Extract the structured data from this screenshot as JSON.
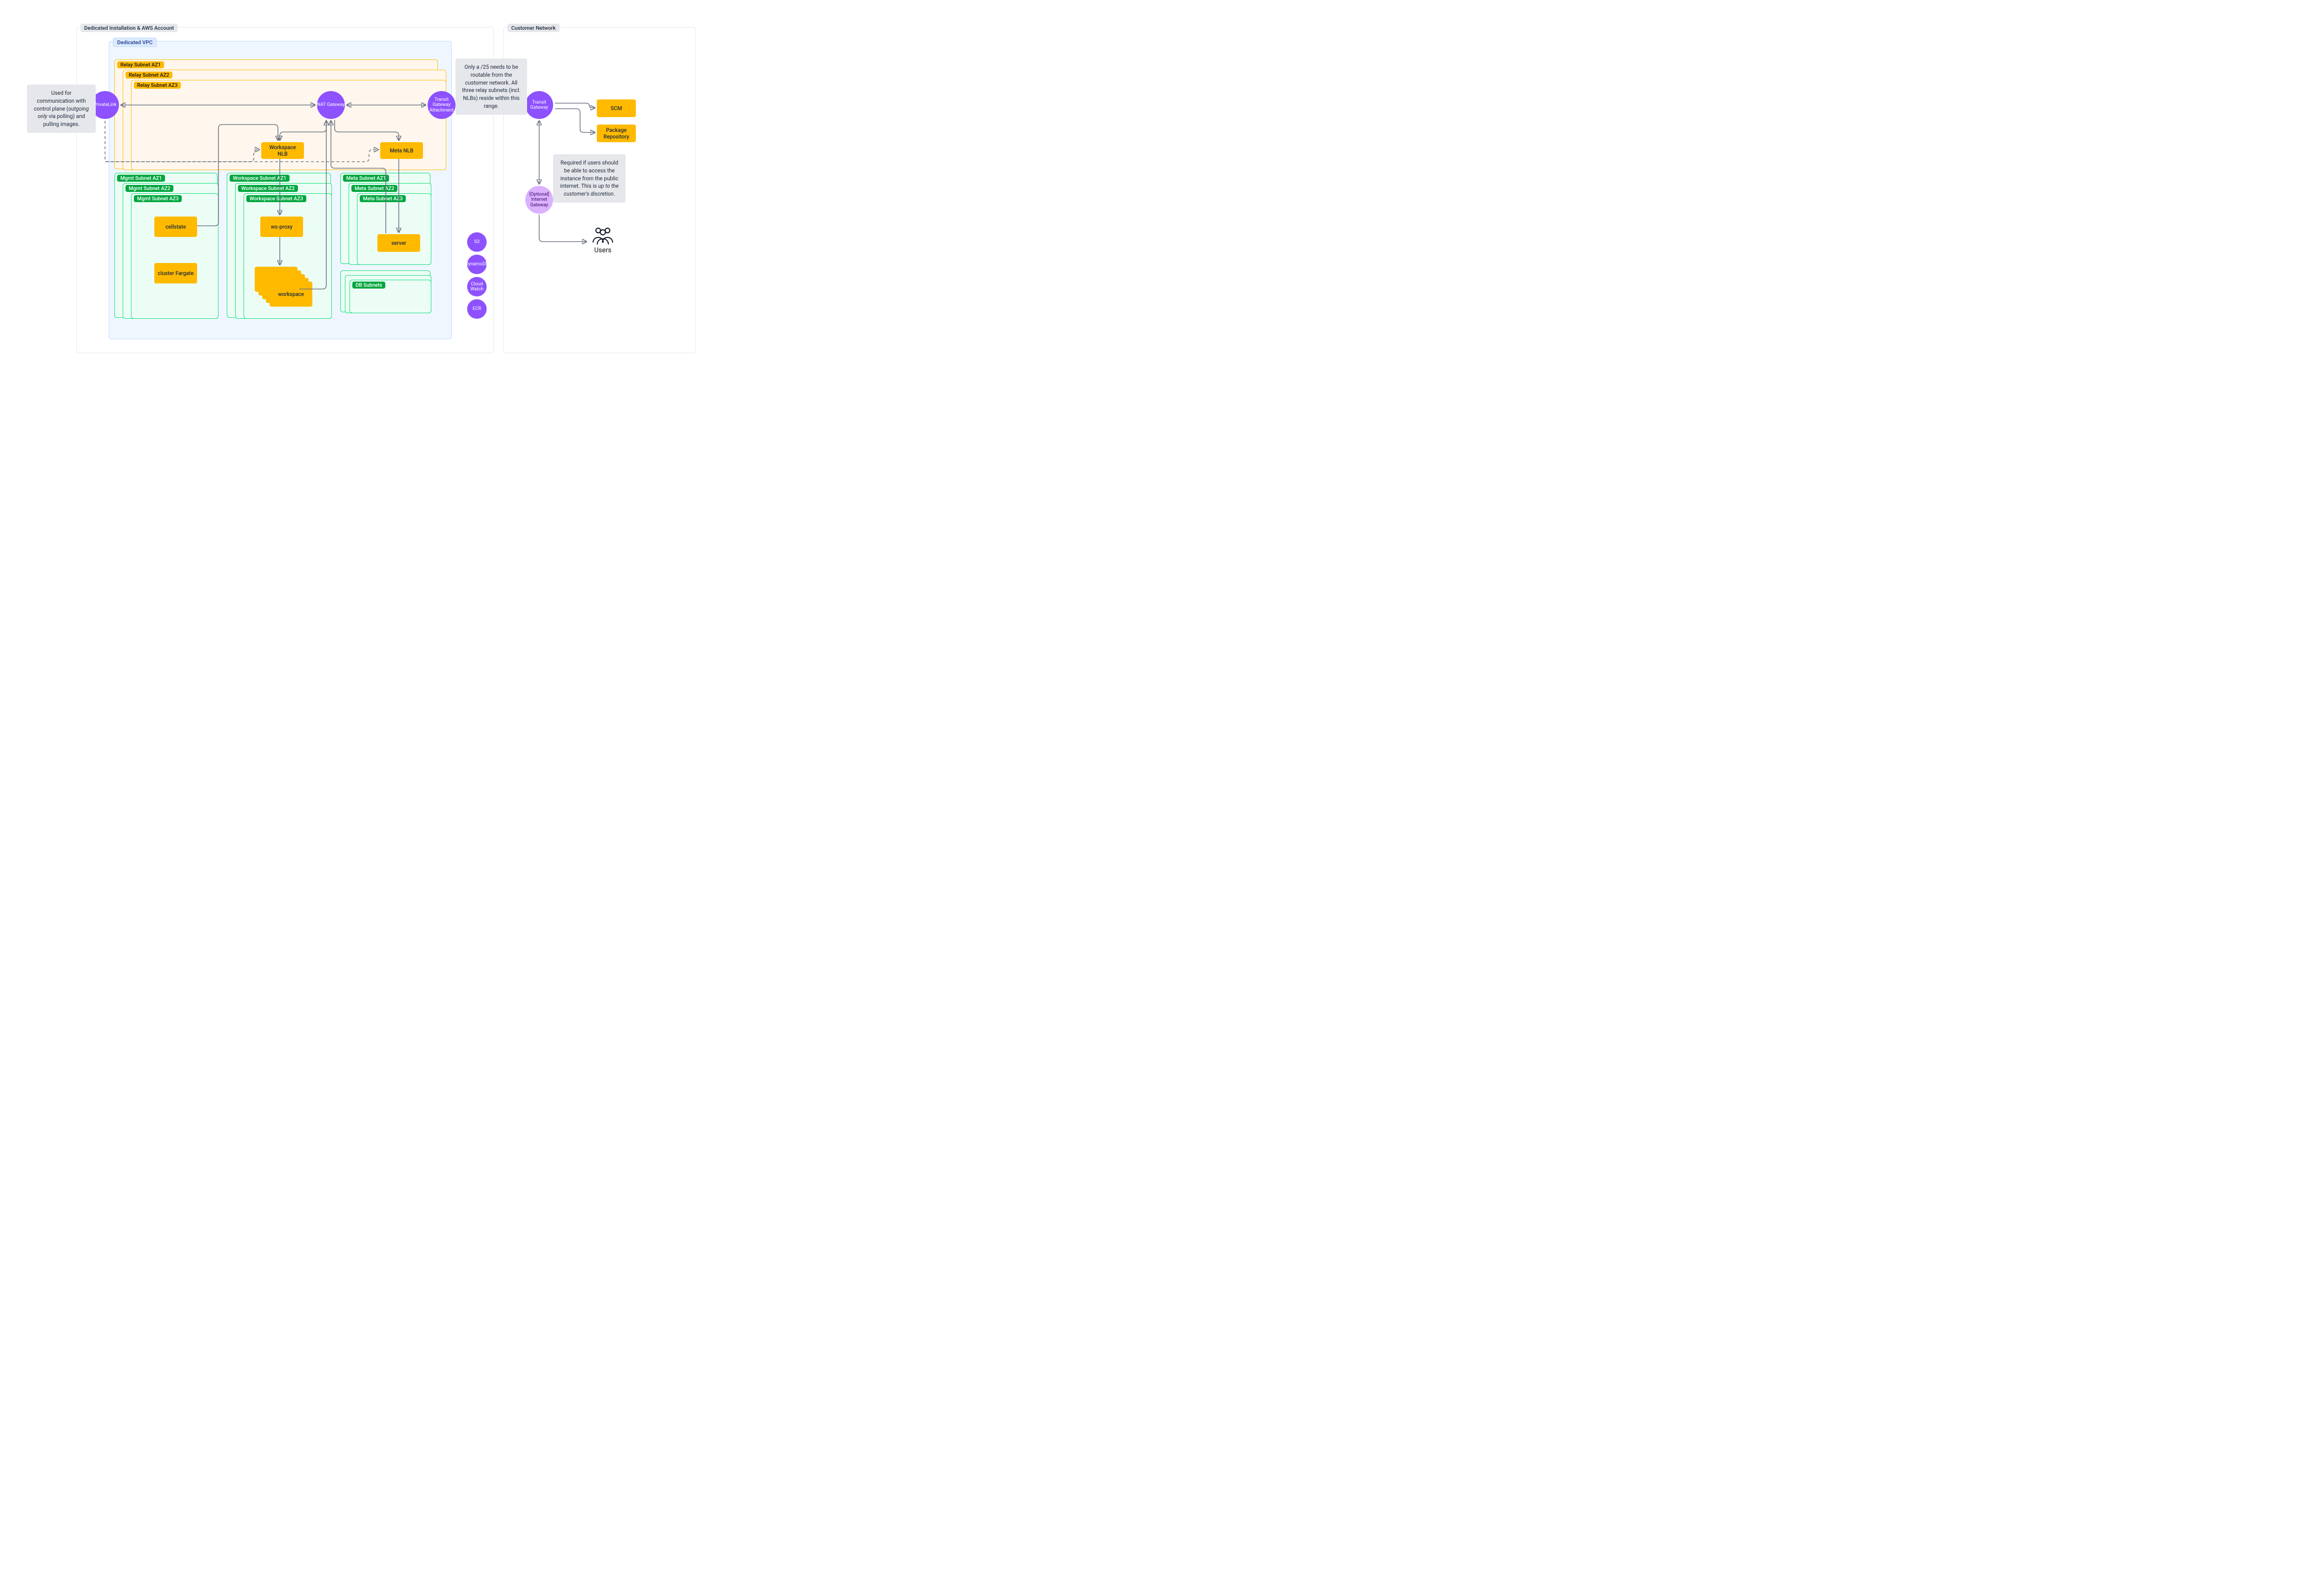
{
  "containers": {
    "install": "Dedicated Installation & AWS Account",
    "vpc": "Dedicated VPC",
    "network": "Customer Network"
  },
  "subnets": {
    "relay": [
      "Relay Subnet AZ1",
      "Relay Subnet AZ2",
      "Relay Subnet AZ3"
    ],
    "mgmt": [
      "Mgmt Subnet AZ1",
      "Mgmt Subnet AZ2",
      "Mgmt Subnet AZ3"
    ],
    "ws": [
      "Workspace Subnet AZ1",
      "Workspace Subnet AZ2",
      "Workspace Subnet AZ3"
    ],
    "meta": [
      "Meta Subnet AZ1",
      "Meta Subnet AZ2",
      "Meta Subnet AZ3"
    ],
    "db": "DB Subnets"
  },
  "circles": {
    "privatelink": "PrivateLink",
    "nat": "NAT Gateway",
    "tga": "Transit Gateway Attachment",
    "tgw": "Transit Gateway",
    "igw": "[Optional] Internet Gateway",
    "s3": "S3",
    "ddb": "DynamoDB",
    "cw": "Cloud Watch",
    "ecr": "ECR"
  },
  "nodes": {
    "ws_nlb": "Workspace NLB",
    "meta_nlb": "Meta NLB",
    "cellstate": "cellstate",
    "fargate": "cluster Fargate",
    "wsproxy": "ws-proxy",
    "workspace": "workspace",
    "server": "server",
    "scm": "SCM",
    "pkg": "Package Repository"
  },
  "notes": {
    "left": "Used for communication with control plane (<em>outgoing only</em> via polling) and pulling images.",
    "top": "Only a /25 needs to be routable from the customer network. All three relay subnets (incl. NLBs) reside within this range.",
    "right": "Required if users should be able to access the instance from the public internet. This is <em>up to the customer's discretion</em>."
  },
  "users": "Users"
}
